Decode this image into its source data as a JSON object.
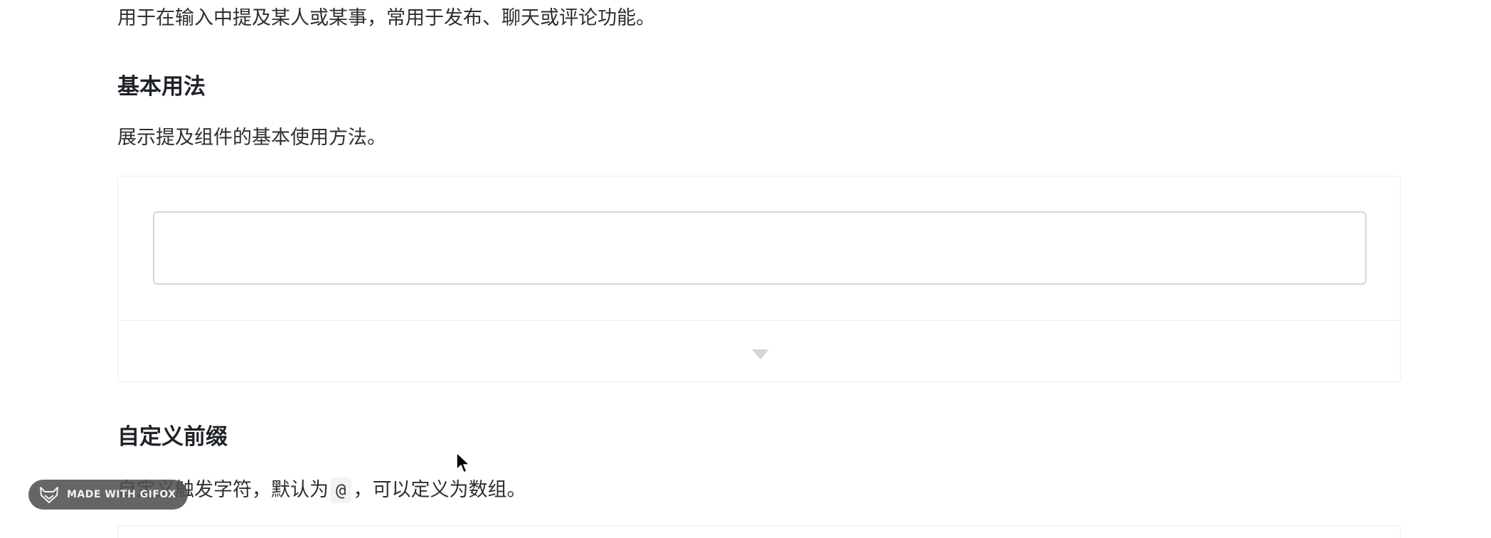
{
  "intro_text": "用于在输入中提及某人或某事，常用于发布、聊天或评论功能。",
  "sections": {
    "basic": {
      "title": "基本用法",
      "description": "展示提及组件的基本使用方法。"
    },
    "prefix": {
      "title": "自定义前缀",
      "description_before": "自定义触发字符，默认为",
      "description_code": "@",
      "description_after": "，可以定义为数组。"
    }
  },
  "watermark": {
    "label": "MADE WITH GIFOX"
  },
  "icons": {
    "expand": "caret-down-icon",
    "cursor": "mouse-pointer-icon",
    "watermark_logo": "fox-icon"
  },
  "colors": {
    "border": "#ebedf0",
    "input_border": "#d3d5d9",
    "caret": "#cfd6de",
    "watermark_bg": "#505050"
  }
}
